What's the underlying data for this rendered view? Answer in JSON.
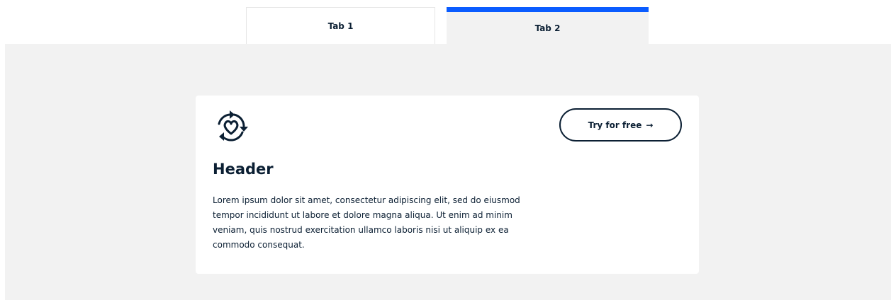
{
  "tabs": [
    {
      "label": "Tab 1",
      "active": false
    },
    {
      "label": "Tab 2",
      "active": true
    }
  ],
  "card": {
    "icon": "heart-cycle-icon",
    "title": "Header",
    "body": "Lorem ipsum dolor sit amet, consectetur adipiscing elit, sed do eiusmod tempor incididunt ut labore et dolore magna aliqua. Ut enim ad minim veniam, quis nostrud exercitation ullamco laboris nisi ut aliquip ex ea commodo consequat.",
    "cta_label": "Try for free",
    "cta_arrow": "→"
  },
  "colors": {
    "accent": "#0a5cff",
    "text": "#0b1f33",
    "panel_bg": "#f2f2f2",
    "card_bg": "#ffffff"
  }
}
